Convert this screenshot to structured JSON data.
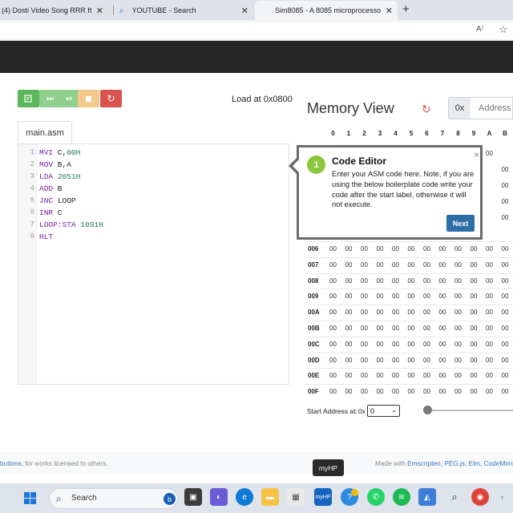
{
  "browser": {
    "tabs": [
      {
        "label": "(4) Dosti Video Song RRR ft",
        "close": "✕"
      },
      {
        "label": "YOUTUBE - Search",
        "close": "✕"
      },
      {
        "label": "Sim8085 - A 8085 microprocesso",
        "close": "✕"
      }
    ],
    "new_tab": "+",
    "read_aloud": "A⁾",
    "favorite": "☆"
  },
  "toolbar": {
    "load_at": "Load at 0x0800"
  },
  "editor": {
    "tab_label": "main.asm",
    "lines": [
      {
        "n": "1",
        "mnemonic": "MVI",
        "rest": " C,",
        "num": "00H"
      },
      {
        "n": "2",
        "mnemonic": "MOV",
        "rest": " B,A",
        "num": ""
      },
      {
        "n": "3",
        "mnemonic": "LDA",
        "rest": " ",
        "num": "2051H"
      },
      {
        "n": "4",
        "mnemonic": "ADD",
        "rest": " B",
        "num": ""
      },
      {
        "n": "5",
        "mnemonic": "JNC",
        "rest": " LOOP",
        "num": ""
      },
      {
        "n": "6",
        "mnemonic": "INR",
        "rest": " C",
        "num": ""
      },
      {
        "n": "7",
        "mnemonic": "LOOP:STA",
        "rest": " ",
        "num": "1091H"
      },
      {
        "n": "8",
        "mnemonic": "HLT",
        "rest": "",
        "num": ""
      }
    ]
  },
  "memory": {
    "title": "Memory View",
    "prefix": "0x",
    "address_placeholder": "Address i",
    "col_headers": [
      "0",
      "1",
      "2",
      "3",
      "4",
      "5",
      "6",
      "7",
      "8",
      "9",
      "A",
      "B"
    ],
    "visible_top_cells": [
      "00",
      "00",
      "00",
      "00",
      "00"
    ],
    "rows": [
      "006",
      "007",
      "008",
      "009",
      "00A",
      "00B",
      "00C",
      "00D",
      "00E",
      "00F"
    ],
    "cell_value": "00",
    "start_address_label": "Start Address at:",
    "start_prefix": "0x",
    "start_value": "0"
  },
  "popup": {
    "step": "1",
    "title": "Code Editor",
    "body": "Enter your ASM code here. Note, if you are using the below boilerplate code write your code after the start label, otherwise it will not execute.",
    "next_label": "Next",
    "close": "×"
  },
  "footer": {
    "left_text": "butions",
    "left_rest": ", for works licensed to others.",
    "made_with": "Made with ",
    "links": "Emscripten, PEG.js, Elm, CodeMirro"
  },
  "taskbar": {
    "search_label": "Search",
    "tooltip": "myHP"
  },
  "colors": {
    "green": "#5cb85c",
    "green_light": "#8fd08f",
    "orange": "#f0ad4e",
    "red": "#d9534f",
    "next_blue": "#2e6ea6",
    "step_green": "#8cc63f"
  }
}
